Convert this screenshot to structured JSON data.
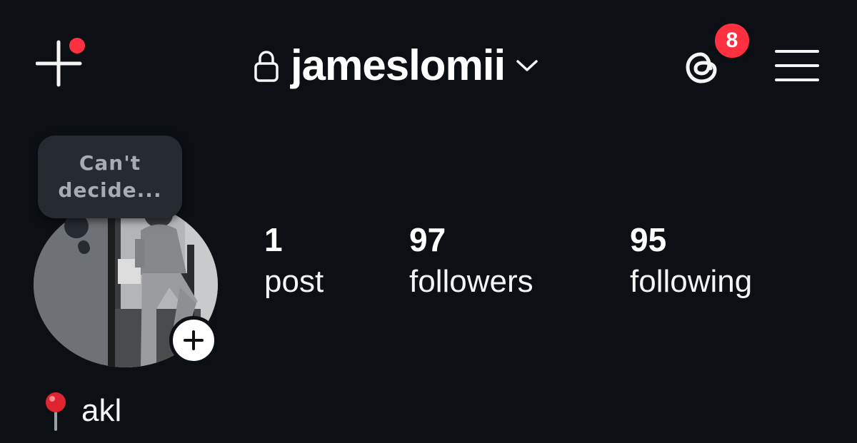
{
  "header": {
    "username": "jameslomii",
    "notification_count": "8"
  },
  "profile": {
    "note": {
      "line1": "Can't",
      "line2": "decide..."
    },
    "stats": {
      "posts": {
        "value": "1",
        "label": "post"
      },
      "followers": {
        "value": "97",
        "label": "followers"
      },
      "following": {
        "value": "95",
        "label": "following"
      }
    },
    "location": "akl"
  },
  "icons": {
    "new_post": "plus-icon",
    "lock": "lock-icon",
    "switcher": "chevron-down-icon",
    "threads": "threads-icon",
    "menu": "hamburger-menu-icon",
    "add_story": "plus-icon",
    "location": "pin-icon"
  },
  "colors": {
    "background": "#0c1014",
    "badge": "#ff3040",
    "note_bubble": "#262a31",
    "text": "#f5f5f5"
  }
}
